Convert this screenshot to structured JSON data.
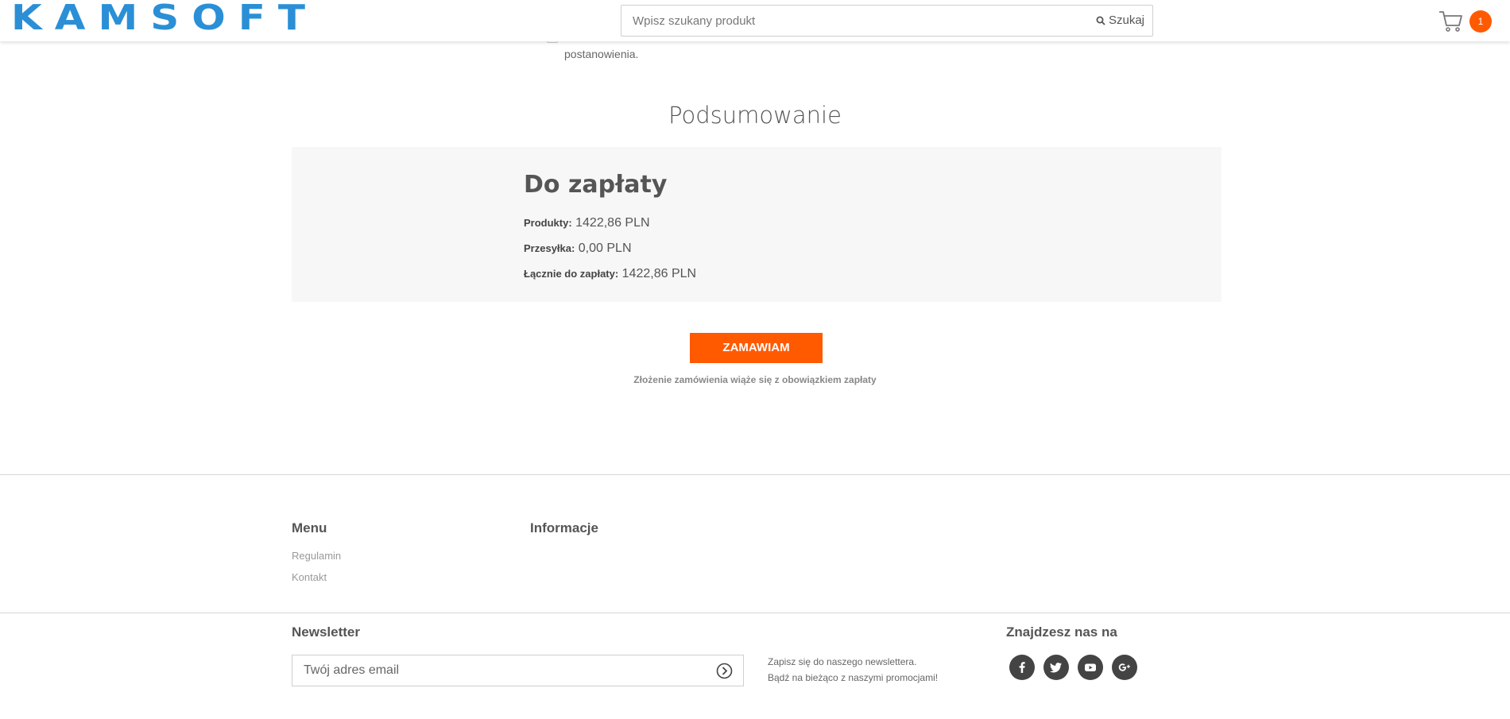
{
  "header": {
    "logo_text": "KAMSOFT",
    "search_placeholder": "Wpisz szukany produkt",
    "search_button": "Szukaj",
    "cart_count": "1"
  },
  "leftover_text": "postanowienia.",
  "summary": {
    "section_title": "Podsumowanie",
    "due_title": "Do zapłaty",
    "rows": [
      {
        "label": "Produkty:",
        "value": "1422,86 PLN"
      },
      {
        "label": "Przesyłka:",
        "value": "0,00 PLN"
      },
      {
        "label": "Łącznie do zapłaty:",
        "value": "1422,86 PLN"
      }
    ],
    "order_button": "ZAMAWIAM",
    "order_note": "Złożenie zamówienia wiąże się z obowiązkiem zapłaty"
  },
  "footer": {
    "menu_heading": "Menu",
    "menu_links": [
      "Regulamin",
      "Kontakt"
    ],
    "info_heading": "Informacje",
    "newsletter_heading": "Newsletter",
    "newsletter_placeholder": "Twój adres email",
    "newsletter_text_1": "Zapisz się do naszego newslettera.",
    "newsletter_text_2": "Bądź na bieżąco z naszymi promocjami!",
    "social_heading": "Znajdzesz nas na",
    "social_icons": [
      "facebook-icon",
      "twitter-icon",
      "youtube-icon",
      "google-plus-icon"
    ]
  },
  "colors": {
    "brand_blue": "#2a8fd6",
    "accent_orange": "#ff5a00",
    "summary_bg": "#f7f7f7"
  }
}
